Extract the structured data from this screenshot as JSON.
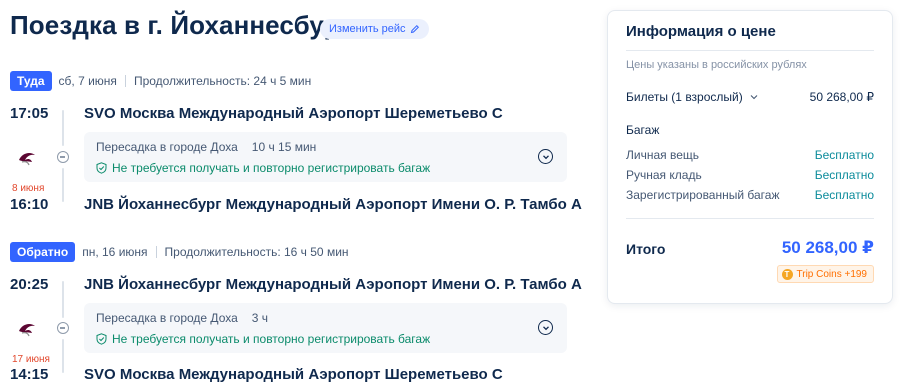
{
  "page": {
    "title": "Поездка в г. Йоханнесбург",
    "change_flight_label": "Изменить рейс"
  },
  "outbound": {
    "badge": "Туда",
    "date": "сб, 7 июня",
    "duration": "Продолжительность: 24 ч 5 мин",
    "departure_time": "17:05",
    "departure_airport": "SVO Москва Международный Аэропорт Шереметьево C",
    "transfer_city": "Пересадка в городе Доха",
    "transfer_duration": "10 ч 15 мин",
    "baggage_note": "Не требуется получать и повторно регистрировать багаж",
    "arrival_date_note": "8 июня",
    "arrival_time": "16:10",
    "arrival_airport": "JNB Йоханнесбург Международный Аэропорт Имени О. Р. Тамбо A"
  },
  "return": {
    "badge": "Обратно",
    "date": "пн, 16 июня",
    "duration": "Продолжительность: 16 ч 50 мин",
    "departure_time": "20:25",
    "departure_airport": "JNB Йоханнесбург Международный Аэропорт Имени О. Р. Тамбо A",
    "transfer_city": "Пересадка в городе Доха",
    "transfer_duration": "3 ч",
    "baggage_note": "Не требуется получать и повторно регистрировать багаж",
    "arrival_date_note": "17 июня",
    "arrival_time": "14:15",
    "arrival_airport": "SVO Москва Международный Аэропорт Шереметьево C"
  },
  "price_info": {
    "title": "Информация о цене",
    "currency_note": "Цены указаны в российских рублях",
    "tickets_label": "Билеты (1 взрослый)",
    "tickets_price": "50 268,00 ₽",
    "baggage_title": "Багаж",
    "baggage": [
      {
        "label": "Личная вещь",
        "value": "Бесплатно"
      },
      {
        "label": "Ручная кладь",
        "value": "Бесплатно"
      },
      {
        "label": "Зарегистрированный багаж",
        "value": "Бесплатно"
      }
    ],
    "total_label": "Итого",
    "total_value": "50 268,00 ₽",
    "coins_label": "Trip Coins +199",
    "coin_symbol": "T"
  },
  "colors": {
    "accent": "#3264ff",
    "text_primary": "#0f294d",
    "success": "#0b8b6b",
    "warning": "#e2472c",
    "coins": "#ff6f00"
  },
  "icons": {
    "edit": "pencil-icon",
    "airline": "airline-logo-icon",
    "shield": "shield-check-icon",
    "expand": "chevron-down-icon",
    "dropdown": "chevron-down-icon",
    "coin": "trip-coin-icon"
  }
}
